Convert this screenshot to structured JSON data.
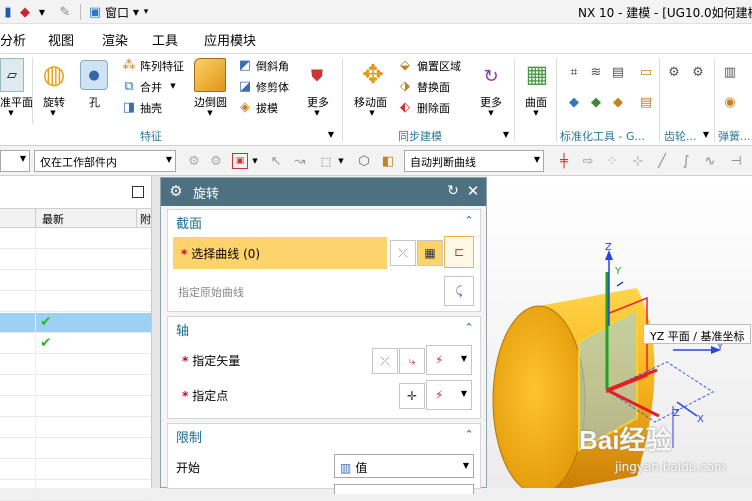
{
  "titlebar": {
    "window_menu": "窗口",
    "app_title": "NX 10 - 建模 - [UG10.0如何建模"
  },
  "menu": {
    "items": [
      "分析",
      "视图",
      "渲染",
      "工具",
      "应用模块"
    ]
  },
  "ribbon": {
    "datum_plane": "准平面",
    "revolve": "旋转",
    "hole": "孔",
    "pattern_feature": "阵列特征",
    "unite": "合并",
    "shell": "抽壳",
    "edge_blend": "边倒圆",
    "chamfer": "倒斜角",
    "trim_body": "修剪体",
    "draft": "拔模",
    "more1": "更多",
    "move_face": "移动面",
    "offset_region": "偏置区域",
    "replace_face": "替换面",
    "delete_face": "删除面",
    "more2": "更多",
    "surface": "曲面",
    "group_feature": "特征",
    "group_sync": "同步建模",
    "group_std": "标准化工具 - G...",
    "group_gear": "齿轮...",
    "group_spring": "弹簧..."
  },
  "filterbar": {
    "scope": "仅在工作部件内",
    "curve_rule": "自动判断曲线"
  },
  "navigator": {
    "col_latest": "最新",
    "col_extra": "附",
    "selected_row": 5,
    "checked_rows": [
      5,
      6
    ]
  },
  "dialog": {
    "title": "旋转",
    "section1": {
      "title": "截面",
      "select_curve": "选择曲线 (0)",
      "specify_origin": "指定原始曲线"
    },
    "section2": {
      "title": "轴",
      "specify_vector": "指定矢量",
      "specify_point": "指定点"
    },
    "section3": {
      "title": "限制",
      "start_label": "开始",
      "start_value": "值"
    }
  },
  "viewport": {
    "tooltip": "YZ 平面 / 基准坐标",
    "axes": {
      "z": "Z",
      "y": "Y",
      "x": "X"
    },
    "watermark_brand": "Bai经验",
    "watermark_url": "jingyan.baidu.com"
  },
  "colors": {
    "accent": "#1c6d8c",
    "highlight": "#fdd36c",
    "dialog_header": "#4d7180",
    "selection": "#9ed0f5"
  }
}
